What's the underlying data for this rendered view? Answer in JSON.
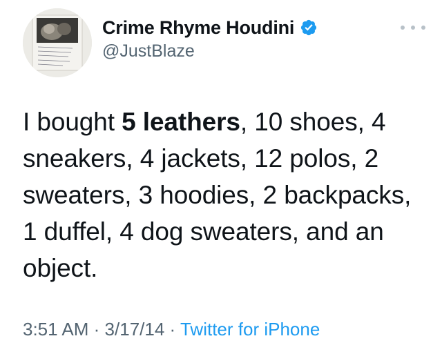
{
  "author": {
    "display_name": "Crime Rhyme Houdini",
    "handle": "@JustBlaze",
    "verified": true,
    "avatar_icon": "profile-photo"
  },
  "menu": {
    "icon": "more-options-icon"
  },
  "tweet": {
    "text_before": "I bought ",
    "text_bold": "5 leathers",
    "text_after": ", 10 shoes, 4 sneakers, 4 jackets, 12 polos, 2 sweaters, 3 hoodies, 2 backpacks, 1 duffel, 4 dog sweaters, and an object."
  },
  "meta": {
    "time": "3:51 AM",
    "separator": "·",
    "date": "3/17/14",
    "source": "Twitter for iPhone"
  },
  "colors": {
    "text": "#0f1419",
    "secondary": "#536471",
    "link": "#1d9bf0",
    "verified": "#1d9bf0"
  }
}
